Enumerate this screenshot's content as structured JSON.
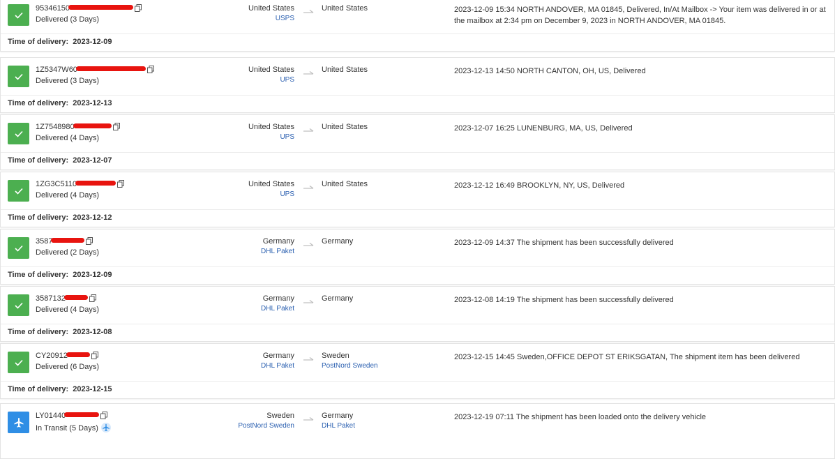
{
  "shipments": [
    {
      "icon": "check",
      "status_type": "delivered",
      "tracking": "95346150",
      "redact_w": 93,
      "status": "Delivered (3 Days)",
      "origin_country": "United States",
      "origin_carrier": "USPS",
      "dest_country": "United States",
      "dest_carrier": "",
      "event": "2023-12-09 15:34  NORTH ANDOVER, MA 01845, Delivered, In/At Mailbox -> Your item was delivered in or at the mailbox at 2:34 pm on December 9, 2023 in NORTH ANDOVER, MA 01845.",
      "delivery_label": "Time of delivery:",
      "delivery_date": "2023-12-09"
    },
    {
      "icon": "check",
      "status_type": "delivered",
      "tracking": "1Z5347W60",
      "redact_w": 100,
      "status": "Delivered (3 Days)",
      "origin_country": "United States",
      "origin_carrier": "UPS",
      "dest_country": "United States",
      "dest_carrier": "",
      "event": "2023-12-13 14:50  NORTH CANTON, OH, US, Delivered",
      "delivery_label": "Time of delivery:",
      "delivery_date": "2023-12-13"
    },
    {
      "icon": "check",
      "status_type": "delivered",
      "tracking": "1Z7548980",
      "redact_w": 55,
      "status": "Delivered (4 Days)",
      "origin_country": "United States",
      "origin_carrier": "UPS",
      "dest_country": "United States",
      "dest_carrier": "",
      "event": "2023-12-07 16:25  LUNENBURG, MA, US, Delivered",
      "delivery_label": "Time of delivery:",
      "delivery_date": "2023-12-07"
    },
    {
      "icon": "check",
      "status_type": "delivered",
      "tracking": "1ZG3C5110",
      "redact_w": 58,
      "status": "Delivered (4 Days)",
      "origin_country": "United States",
      "origin_carrier": "UPS",
      "dest_country": "United States",
      "dest_carrier": "",
      "event": "2023-12-12 16:49  BROOKLYN, NY, US, Delivered",
      "delivery_label": "Time of delivery:",
      "delivery_date": "2023-12-12"
    },
    {
      "icon": "check",
      "status_type": "delivered",
      "tracking": "3587",
      "redact_w": 48,
      "status": "Delivered (2 Days)",
      "origin_country": "Germany",
      "origin_carrier": "DHL Paket",
      "dest_country": "Germany",
      "dest_carrier": "",
      "event": "2023-12-09 14:37  The shipment has been successfully delivered",
      "delivery_label": "Time of delivery:",
      "delivery_date": "2023-12-09"
    },
    {
      "icon": "check",
      "status_type": "delivered",
      "tracking": "3587132",
      "redact_w": 34,
      "status": "Delivered (4 Days)",
      "origin_country": "Germany",
      "origin_carrier": "DHL Paket",
      "dest_country": "Germany",
      "dest_carrier": "",
      "event": "2023-12-08 14:19  The shipment has been successfully delivered",
      "delivery_label": "Time of delivery:",
      "delivery_date": "2023-12-08"
    },
    {
      "icon": "check",
      "status_type": "delivered",
      "tracking": "CY20912",
      "redact_w": 34,
      "status": "Delivered (6 Days)",
      "origin_country": "Germany",
      "origin_carrier": "DHL Paket",
      "dest_country": "Sweden",
      "dest_carrier": "PostNord Sweden",
      "event": "2023-12-15 14:45  Sweden,OFFICE DEPOT ST ERIKSGATAN, The shipment item has been delivered",
      "delivery_label": "Time of delivery:",
      "delivery_date": "2023-12-15"
    },
    {
      "icon": "plane",
      "status_type": "transit",
      "tracking": "LY01440",
      "redact_w": 50,
      "status": "In Transit (5 Days)",
      "origin_country": "Sweden",
      "origin_carrier": "PostNord Sweden",
      "dest_country": "Germany",
      "dest_carrier": "DHL Paket",
      "event": "2023-12-19 07:11  The shipment has been loaded onto the delivery vehicle",
      "delivery_label": "",
      "delivery_date": ""
    }
  ]
}
